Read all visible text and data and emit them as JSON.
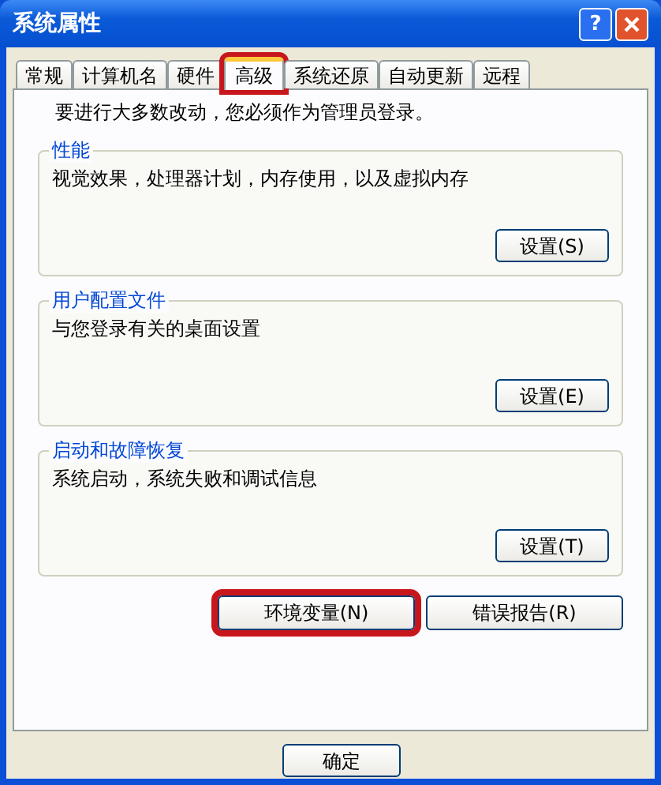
{
  "window": {
    "title": "系统属性",
    "title_buttons": [
      {
        "kind": "help",
        "label": "?"
      },
      {
        "kind": "close"
      }
    ]
  },
  "tabs": [
    {
      "label": "常规",
      "selected": false,
      "highlighted": false
    },
    {
      "label": "计算机名",
      "selected": false,
      "highlighted": false
    },
    {
      "label": "硬件",
      "selected": false,
      "highlighted": false
    },
    {
      "label": "高级",
      "selected": true,
      "highlighted": true
    },
    {
      "label": "系统还原",
      "selected": false,
      "highlighted": false
    },
    {
      "label": "自动更新",
      "selected": false,
      "highlighted": false
    },
    {
      "label": "远程",
      "selected": false,
      "highlighted": false
    }
  ],
  "notice": "要进行大多数改动，您必须作为管理员登录。",
  "groups": [
    {
      "title": "性能",
      "description": "视觉效果，处理器计划，内存使用，以及虚拟内存",
      "button": "设置(S)"
    },
    {
      "title": "用户配置文件",
      "description": "与您登录有关的桌面设置",
      "button": "设置(E)"
    },
    {
      "title": "启动和故障恢复",
      "description": "系统启动，系统失败和调试信息",
      "button": "设置(T)"
    }
  ],
  "buttons": [
    {
      "label": "环境变量(N)",
      "highlighted": true
    },
    {
      "label": "错误报告(R)",
      "highlighted": false
    }
  ],
  "footer_buttons": [
    {
      "label": "确定"
    }
  ]
}
